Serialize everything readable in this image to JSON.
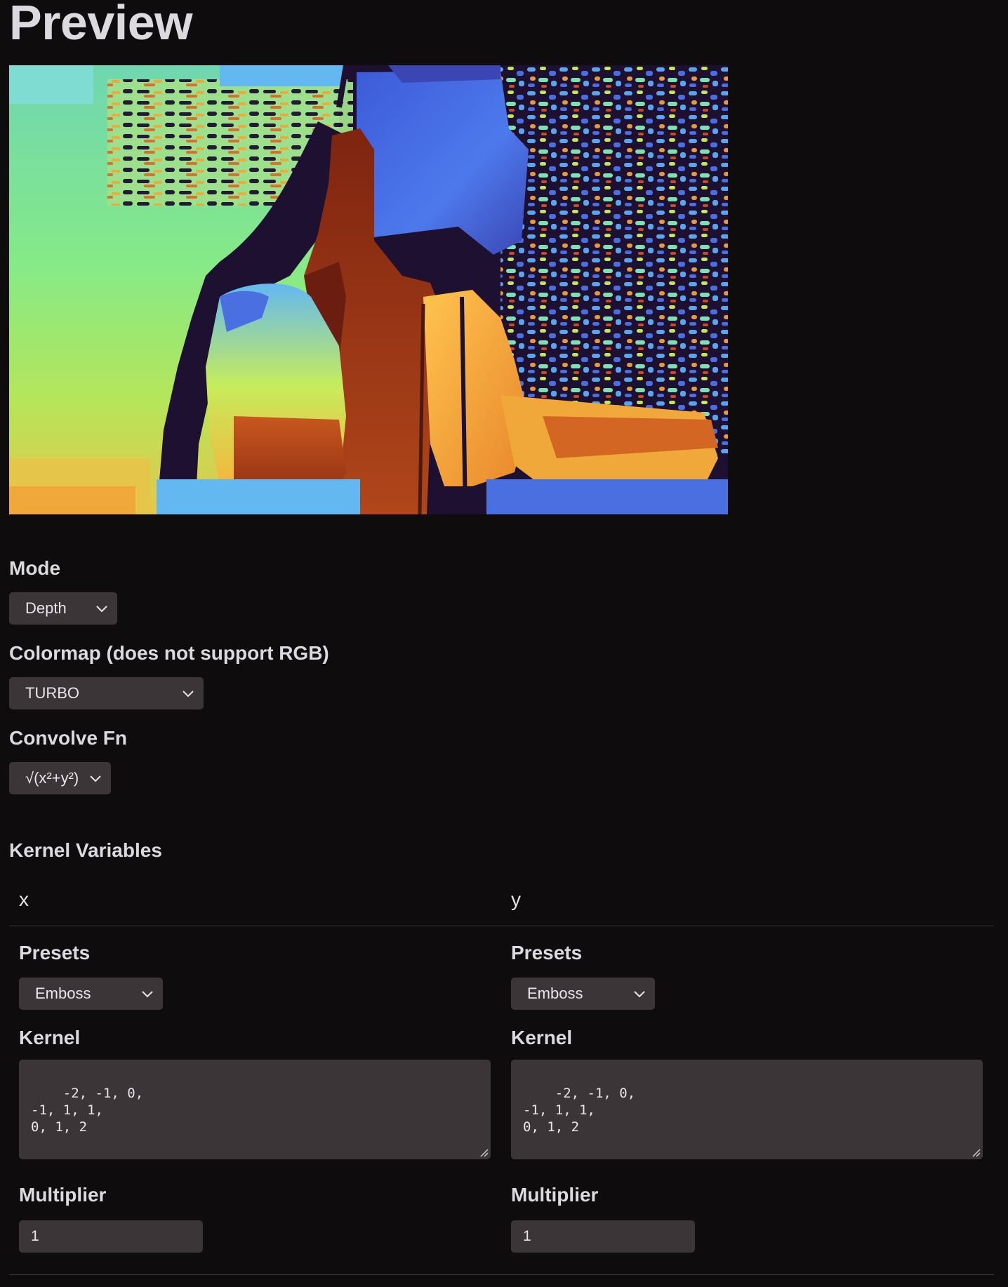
{
  "page": {
    "title": "Preview"
  },
  "controls": {
    "mode": {
      "label": "Mode",
      "value": "Depth"
    },
    "colormap": {
      "label": "Colormap (does not support RGB)",
      "value": "TURBO"
    },
    "convolve_fn": {
      "label": "Convolve Fn",
      "value": "√(x²+y²)"
    }
  },
  "kernel_variables": {
    "heading": "Kernel Variables",
    "columns": [
      {
        "name": "x",
        "presets_label": "Presets",
        "preset_value": "Emboss",
        "kernel_label": "Kernel",
        "kernel_value": "-2, -1, 0,\n-1, 1, 1,\n0, 1, 2",
        "multiplier_label": "Multiplier",
        "multiplier_value": "1"
      },
      {
        "name": "y",
        "presets_label": "Presets",
        "preset_value": "Emboss",
        "kernel_label": "Kernel",
        "kernel_value": "-2, -1, 0,\n-1, 1, 1,\n0, 1, 2",
        "multiplier_label": "Multiplier",
        "multiplier_value": "1"
      }
    ]
  },
  "icons": {
    "select_indicator": "chevron-down-icon",
    "resize": "resize-grip-icon"
  },
  "colors": {
    "background": "#0f0c0e",
    "control_bg": "#3b3538",
    "text": "#e4e2e6",
    "turbo_green": "#7be38f",
    "turbo_blue": "#4a6fe0",
    "turbo_orange": "#f4a23a",
    "turbo_red": "#8a2a10",
    "turbo_dark": "#1e1030"
  }
}
